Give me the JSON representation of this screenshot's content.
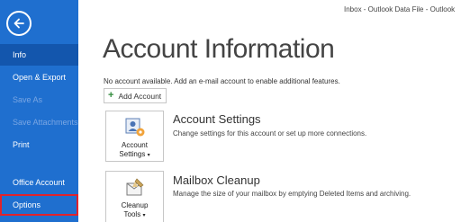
{
  "window": {
    "title": "Inbox - Outlook Data File - Outlook"
  },
  "sidebar": {
    "items": [
      {
        "label": "Info"
      },
      {
        "label": "Open & Export"
      },
      {
        "label": "Save As"
      },
      {
        "label": "Save Attachments"
      },
      {
        "label": "Print"
      },
      {
        "label": "Office Account"
      },
      {
        "label": "Options"
      }
    ]
  },
  "main": {
    "title": "Account Information",
    "notice": "No account available. Add an e-mail account to enable additional features.",
    "add_account_label": "Add Account",
    "sections": [
      {
        "button_label_1": "Account",
        "button_label_2": "Settings",
        "title": "Account Settings",
        "description": "Change settings for this account or set up more connections."
      },
      {
        "button_label_1": "Cleanup",
        "button_label_2": "Tools",
        "title": "Mailbox Cleanup",
        "description": "Manage the size of your mailbox by emptying Deleted Items and archiving."
      }
    ]
  },
  "colors": {
    "sidebar": "#1f6fcf",
    "sidebar_active": "#1356ad",
    "highlight": "#e0232c"
  }
}
